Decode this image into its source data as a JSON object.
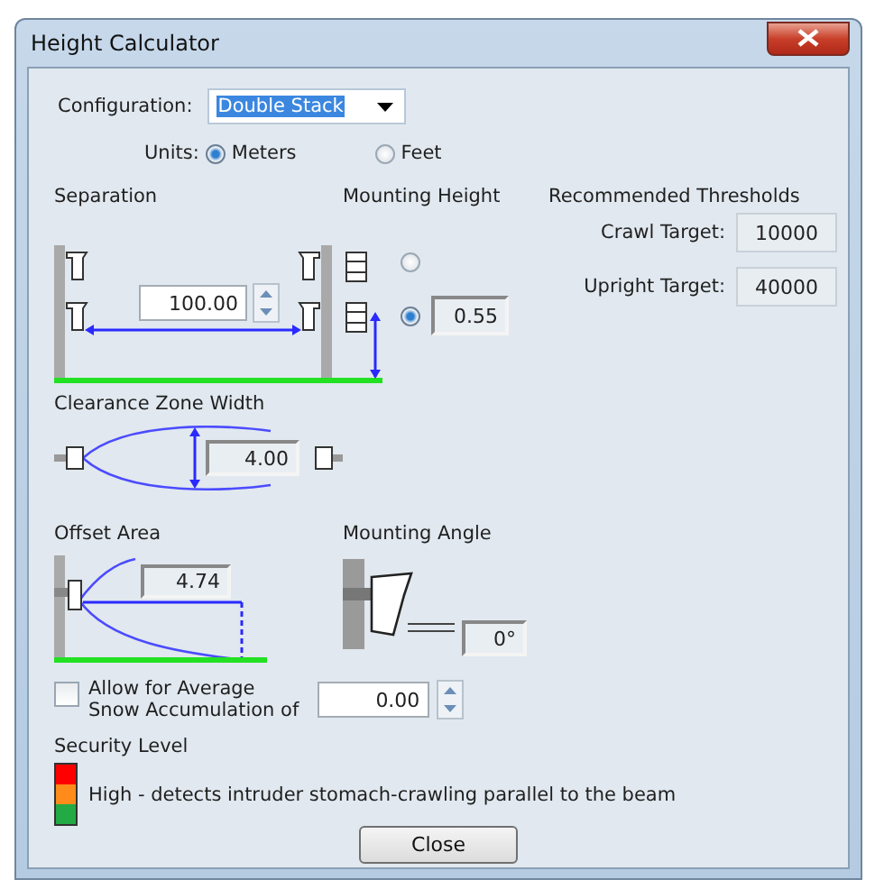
{
  "window": {
    "title": "Height Calculator"
  },
  "configuration": {
    "label": "Configuration:",
    "value": "Double Stack"
  },
  "units": {
    "label": "Units:",
    "options": [
      {
        "label": "Meters",
        "selected": true
      },
      {
        "label": "Feet",
        "selected": false
      }
    ]
  },
  "separation": {
    "label": "Separation",
    "value": "100.00"
  },
  "mounting_height": {
    "label": "Mounting Height",
    "options": [
      {
        "selected": false
      },
      {
        "selected": true
      }
    ],
    "value": "0.55"
  },
  "thresholds": {
    "title": "Recommended Thresholds",
    "items": [
      {
        "label": "Crawl Target:",
        "value": "10000"
      },
      {
        "label": "Upright Target:",
        "value": "40000"
      }
    ]
  },
  "clearance_zone_width": {
    "label": "Clearance Zone Width",
    "value": "4.00"
  },
  "offset_area": {
    "label": "Offset Area",
    "value": "4.74"
  },
  "mounting_angle": {
    "label": "Mounting Angle",
    "value": "0°"
  },
  "snow": {
    "checked": false,
    "label_lines": [
      "Allow for Average",
      "Snow Accumulation of"
    ],
    "value": "0.00"
  },
  "security_level": {
    "label": "Security Level",
    "levels": [
      {
        "color": "#ff0000"
      },
      {
        "color": "#ff8c1a"
      },
      {
        "color": "#22aa44"
      }
    ],
    "description": "High - detects intruder stomach-crawling parallel to the beam"
  },
  "close_button": {
    "label": "Close"
  }
}
